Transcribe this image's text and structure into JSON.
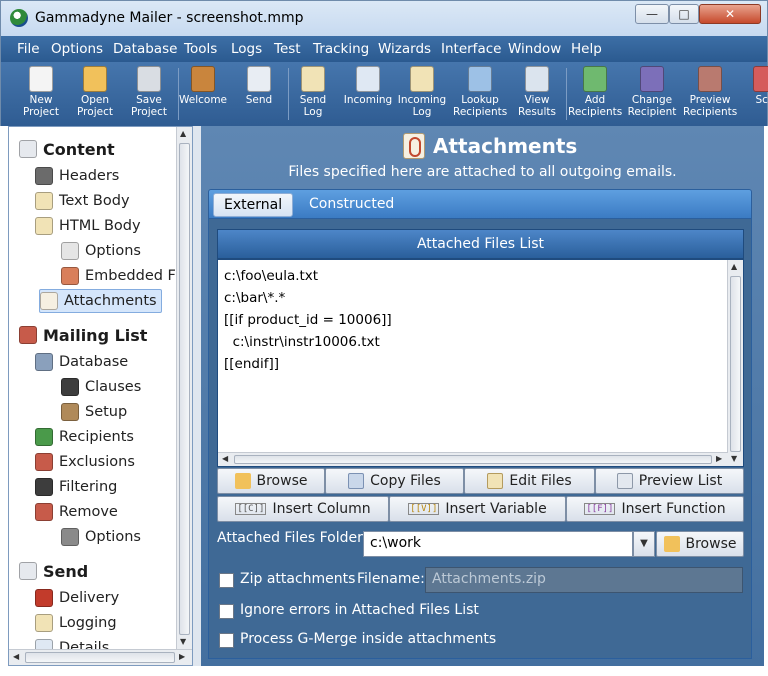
{
  "window": {
    "title": "Gammadyne Mailer - screenshot.mmp",
    "minimize": "—",
    "maximize": "□",
    "close": "✕"
  },
  "menu": [
    "File",
    "Options",
    "Database",
    "Tools",
    "Logs",
    "Test",
    "Tracking",
    "Wizards",
    "Interface",
    "Window",
    "Help"
  ],
  "toolbar": [
    {
      "l1": "New",
      "l2": "Project",
      "icon": "new-project-icon",
      "color": "#f4f4f4"
    },
    {
      "l1": "Open",
      "l2": "Project",
      "icon": "open-project-icon",
      "color": "#f1c15b"
    },
    {
      "l1": "Save",
      "l2": "Project",
      "icon": "save-project-icon",
      "color": "#d9dde3"
    },
    {
      "l1": "Welcome",
      "l2": "",
      "icon": "welcome-door-icon",
      "color": "#c9853d"
    },
    {
      "l1": "Send",
      "l2": "",
      "icon": "send-envelope-icon",
      "color": "#e8edf3"
    },
    {
      "l1": "Send",
      "l2": "Log",
      "icon": "send-log-icon",
      "color": "#f1e3b6"
    },
    {
      "l1": "Incoming",
      "l2": "",
      "icon": "incoming-icon",
      "color": "#dfe8f3"
    },
    {
      "l1": "Incoming",
      "l2": "Log",
      "icon": "incoming-log-icon",
      "color": "#f1e3b6"
    },
    {
      "l1": "Lookup",
      "l2": "Recipients",
      "icon": "lookup-recipients-icon",
      "color": "#9dc1e6"
    },
    {
      "l1": "View",
      "l2": "Results",
      "icon": "view-results-icon",
      "color": "#dbe4ee"
    },
    {
      "l1": "Add",
      "l2": "Recipients",
      "icon": "add-recipients-icon",
      "color": "#6fb96f"
    },
    {
      "l1": "Change",
      "l2": "Recipient",
      "icon": "change-recipient-icon",
      "color": "#7c6fb9"
    },
    {
      "l1": "Preview",
      "l2": "Recipients",
      "icon": "preview-recipients-icon",
      "color": "#b97a6f"
    },
    {
      "l1": "Sch",
      "l2": "",
      "icon": "schedule-icon",
      "color": "#d55c5c"
    }
  ],
  "tree": [
    {
      "label": "Content",
      "icon": "content-envelope-icon",
      "color": "#e6e9ee",
      "level": 0,
      "cat": true
    },
    {
      "label": "Headers",
      "icon": "headers-head-icon",
      "color": "#6b6b6b",
      "level": 1
    },
    {
      "label": "Text Body",
      "icon": "text-body-icon",
      "color": "#f1e3b6",
      "level": 1
    },
    {
      "label": "HTML Body",
      "icon": "html-body-icon",
      "color": "#f1e3b6",
      "level": 1
    },
    {
      "label": "Options",
      "icon": "html-options-icon",
      "color": "#e5e5e5",
      "level": 2
    },
    {
      "label": "Embedded F",
      "icon": "embedded-files-icon",
      "color": "#d97f5b",
      "level": 2
    },
    {
      "label": "Attachments",
      "icon": "attachments-clip-icon",
      "color": "#f6f0e2",
      "level": 1,
      "sel": true
    },
    {
      "label": "Mailing List",
      "icon": "mailing-list-icon",
      "color": "#c75b4a",
      "level": 0,
      "cat": true
    },
    {
      "label": "Database",
      "icon": "database-icon",
      "color": "#8aa0bc",
      "level": 1
    },
    {
      "label": "Clauses",
      "icon": "clauses-icon",
      "color": "#3d3d3d",
      "level": 2
    },
    {
      "label": "Setup",
      "icon": "setup-tools-icon",
      "color": "#b08a5a",
      "level": 2
    },
    {
      "label": "Recipients",
      "icon": "recipients-icon",
      "color": "#4a9a4a",
      "level": 1
    },
    {
      "label": "Exclusions",
      "icon": "exclusions-icon",
      "color": "#c75b4a",
      "level": 1
    },
    {
      "label": "Filtering",
      "icon": "filtering-icon",
      "color": "#3d3d3d",
      "level": 1
    },
    {
      "label": "Remove",
      "icon": "remove-icon",
      "color": "#c75b4a",
      "level": 1
    },
    {
      "label": "Options",
      "icon": "remove-options-icon",
      "color": "#8a8a8a",
      "level": 2
    },
    {
      "label": "Send",
      "icon": "send-envelope-icon",
      "color": "#e6e9ee",
      "level": 0,
      "cat": true
    },
    {
      "label": "Delivery",
      "icon": "delivery-truck-icon",
      "color": "#c23b2b",
      "level": 1
    },
    {
      "label": "Logging",
      "icon": "logging-icon",
      "color": "#f1e3b6",
      "level": 1
    },
    {
      "label": "Details",
      "icon": "details-icon",
      "color": "#dfe8f3",
      "level": 1
    }
  ],
  "main": {
    "title": "Attachments",
    "subtitle": "Files specified here are attached to all outgoing emails.",
    "tabs": [
      "External",
      "Constructed"
    ],
    "list_header": "Attached Files List",
    "list_lines": [
      "c:\\foo\\eula.txt",
      "c:\\bar\\*.*",
      "[[if product_id = 10006]]",
      "  c:\\instr\\instr10006.txt",
      "[[endif]]"
    ],
    "buttons_row1": [
      {
        "label": "Browse",
        "icon": "browse-folder-icon",
        "color": "#f1c15b"
      },
      {
        "label": "Copy Files",
        "icon": "copy-files-icon",
        "color": "#c9d7ea"
      },
      {
        "label": "Edit Files",
        "icon": "edit-files-icon",
        "color": "#f1e3b6"
      },
      {
        "label": "Preview List",
        "icon": "preview-list-icon",
        "color": "#e3e8ef"
      }
    ],
    "buttons_row2": [
      {
        "label": "Insert Column",
        "tag": "[[C]]"
      },
      {
        "label": "Insert Variable",
        "tag": "[[V]]"
      },
      {
        "label": "Insert Function",
        "tag": "[[F]]"
      }
    ],
    "folder_label": "Attached Files Folder:",
    "folder_value": "c:\\work",
    "folder_browse": "Browse",
    "zip_label": "Zip attachments",
    "filename_label": "Filename:",
    "filename_placeholder": "Attachments.zip",
    "ignore_label": "Ignore errors in Attached Files List",
    "merge_label": "Process G-Merge inside attachments"
  }
}
